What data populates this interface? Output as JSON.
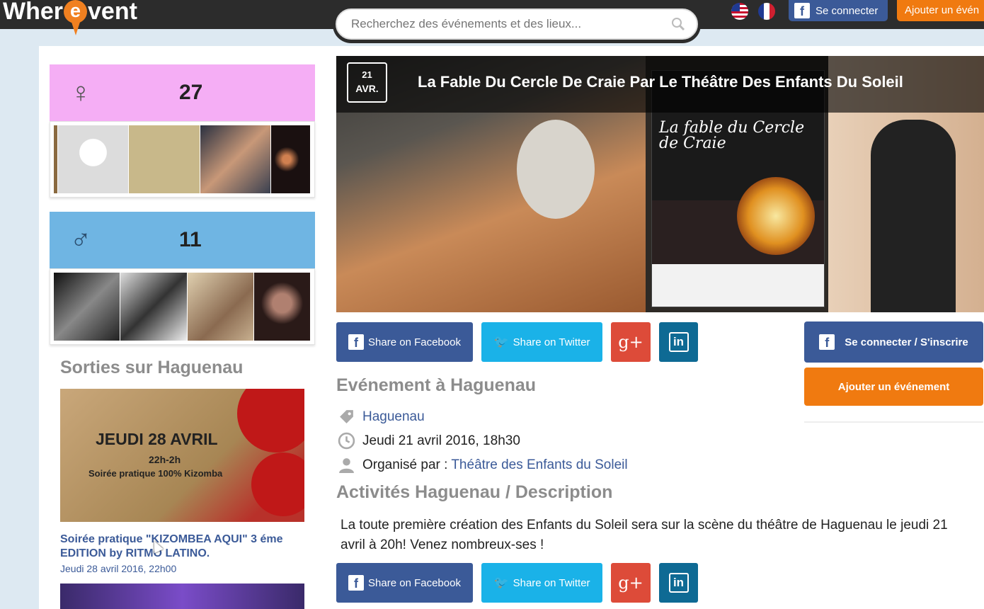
{
  "header": {
    "logo_left": "Wher",
    "logo_pin": "e",
    "logo_right": "vent",
    "search_placeholder": "Recherchez des événements et des lieux...",
    "connect_label": "Se connecter",
    "add_event_label": "Ajouter un évén"
  },
  "sidebar": {
    "female_count": "27",
    "male_count": "11",
    "female_symbol": "♀",
    "male_symbol": "♂",
    "section_title": "Sorties sur Haguenau",
    "event_poster": {
      "line1": "JEUDI 28 AVRIL",
      "line2": "22h-2h",
      "line3": "Soirée pratique 100% Kizomba"
    },
    "event_link": "Soirée pratique \"KIZOMBEA AQUI\" 3 éme EDITION by RITMO LATINO.",
    "event_date": "Jeudi 28 avril 2016, 22h00"
  },
  "event": {
    "day": "21",
    "month": "AVR.",
    "title": "La Fable Du Cercle De Craie Par Le Théâtre Des Enfants Du Soleil",
    "poster_title": "La fable du Cercle de Craie",
    "section_title": "Evénement à Haguenau",
    "location": "Haguenau",
    "datetime": "Jeudi 21 avril 2016, 18h30",
    "organiser_prefix": "Organisé par : ",
    "organiser": "Théâtre des Enfants du Soleil",
    "description_title": "Activités Haguenau / Description",
    "description": "La toute première création des Enfants du Soleil sera sur la scène du théâtre de Haguenau le jeudi 21 avril à 20h! Venez nombreux-ses !"
  },
  "share": {
    "facebook": "Share on Facebook",
    "twitter": "Share on Twitter",
    "google": "g+",
    "linkedin": "in"
  },
  "right": {
    "connect": "Se connecter / S'inscrire",
    "add_event": "Ajouter un événement"
  },
  "colors": {
    "facebook": "#3b5a98",
    "twitter": "#1ab2e8",
    "google": "#dd4b39",
    "linkedin": "#0e6a94",
    "accent": "#f07a10",
    "female": "#f5aef5",
    "male": "#6fb5e3"
  }
}
